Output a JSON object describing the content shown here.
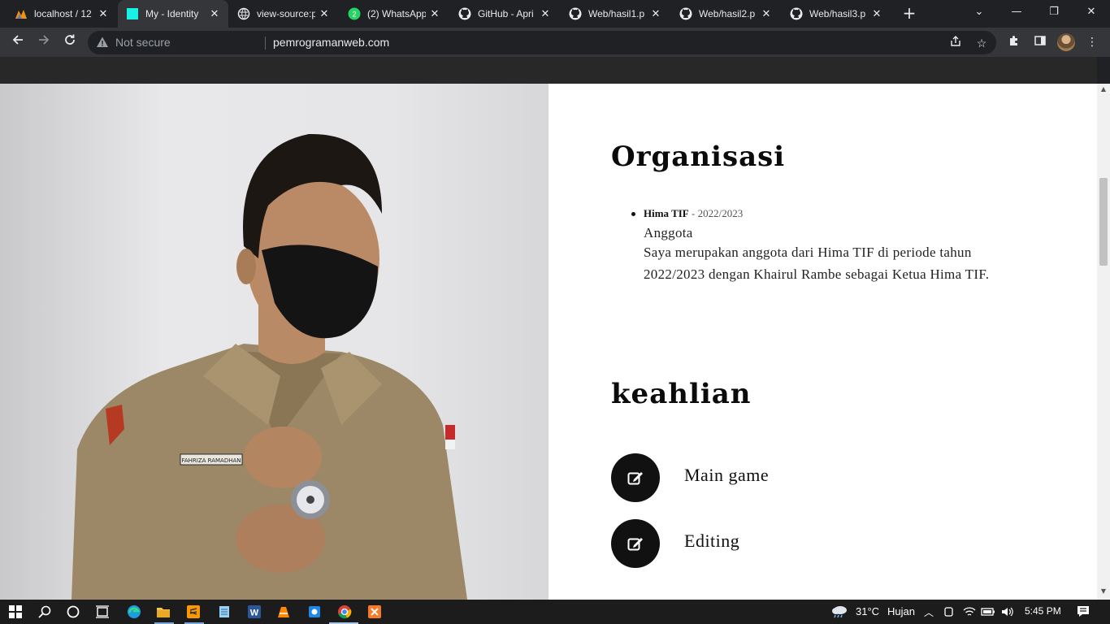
{
  "browser": {
    "tabs": [
      {
        "title": "localhost / 12",
        "icon": "phpmyadmin-icon",
        "active": false
      },
      {
        "title": "My - Identity",
        "icon": "site-favicon-icon",
        "active": true
      },
      {
        "title": "view-source:p",
        "icon": "globe-icon",
        "active": false
      },
      {
        "title": "(2) WhatsApp",
        "icon": "whatsapp-icon",
        "active": false,
        "badge": "2"
      },
      {
        "title": "GitHub - Apri",
        "icon": "github-icon",
        "active": false
      },
      {
        "title": "Web/hasil1.p",
        "icon": "github-icon",
        "active": false
      },
      {
        "title": "Web/hasil2.p",
        "icon": "github-icon",
        "active": false
      },
      {
        "title": "Web/hasil3.p",
        "icon": "github-icon",
        "active": false
      }
    ],
    "security_label": "Not secure",
    "url": "pemrogramanweb.com"
  },
  "page": {
    "organisasi": {
      "heading": "Organisasi",
      "items": [
        {
          "org": "Hima TIF",
          "period": "- 2022/2023",
          "role": "Anggota",
          "description": "Saya merupakan anggota dari Hima TIF di periode tahun 2022/2023 dengan Khairul Rambe sebagai Ketua Hima TIF."
        }
      ]
    },
    "keahlian": {
      "heading": "keahlian",
      "skills": [
        {
          "label": "Main game",
          "icon": "edit-icon"
        },
        {
          "label": "Editing",
          "icon": "edit-icon"
        }
      ]
    },
    "photo": {
      "name_tag": "FAHRIZA RAMADHAN"
    }
  },
  "taskbar": {
    "weather_temp": "31°C",
    "weather_desc": "Hujan",
    "time": "5:45 PM"
  },
  "colors": {
    "tab_bar": "#202124",
    "toolbar": "#35363a",
    "page_nav": "#282828",
    "skill_circle": "#111111"
  }
}
